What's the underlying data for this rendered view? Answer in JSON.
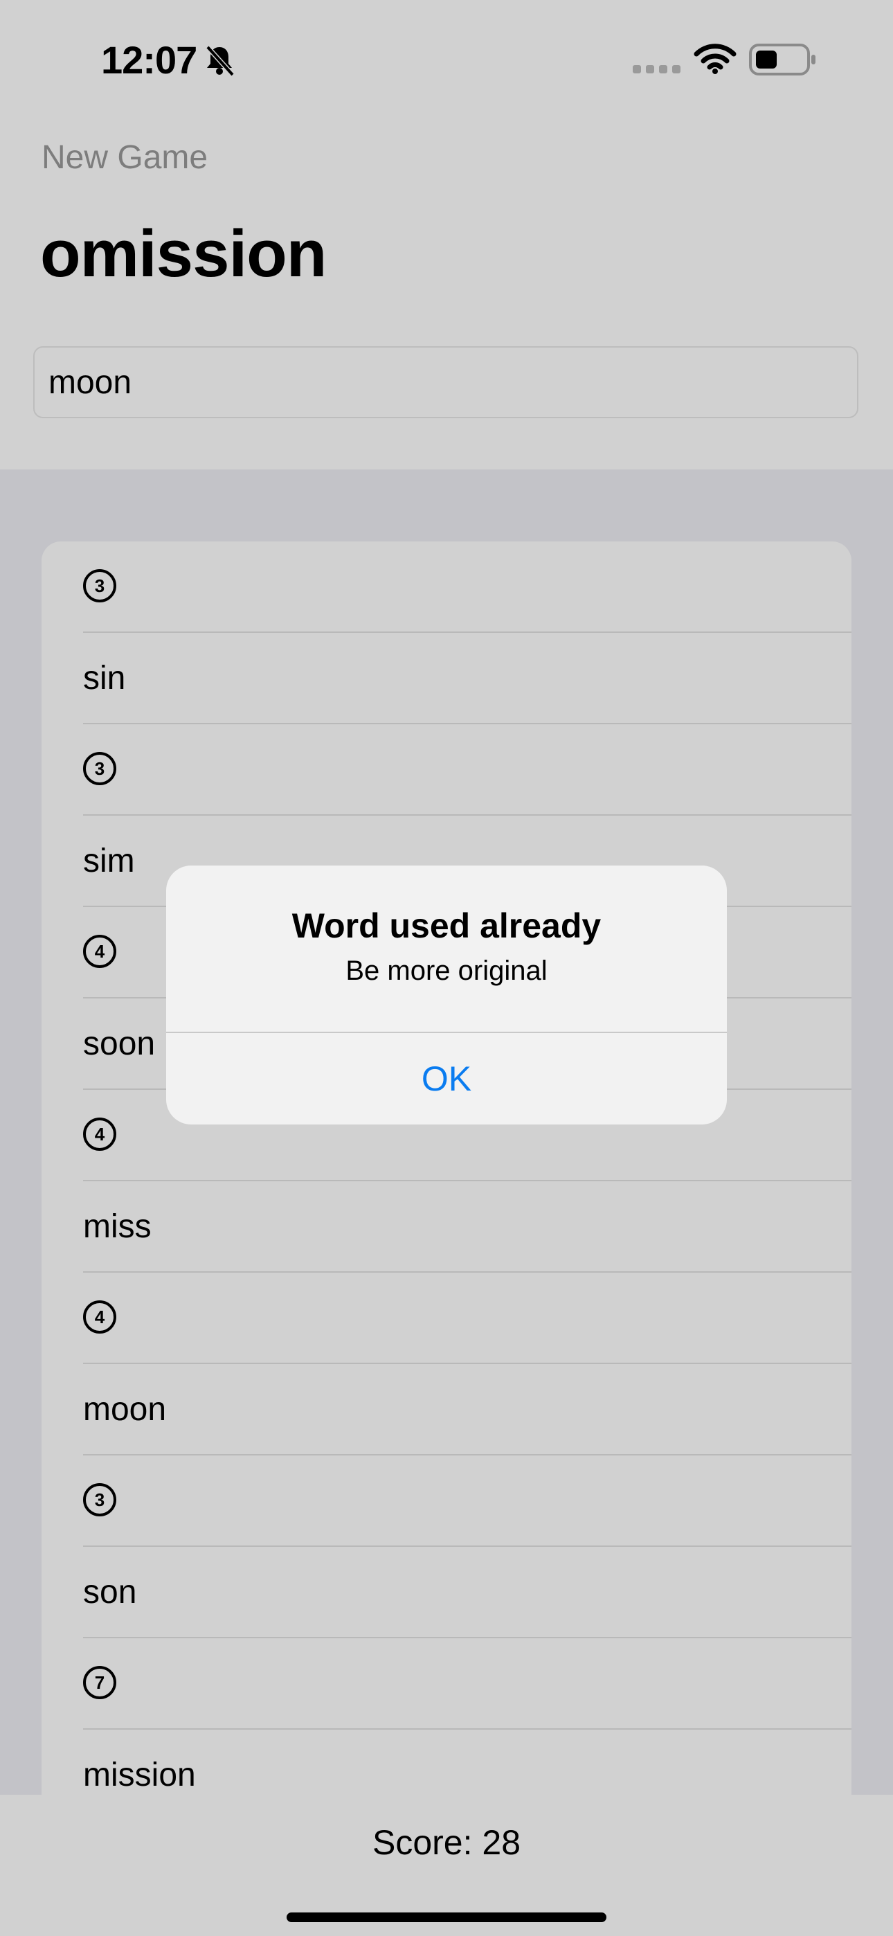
{
  "status_bar": {
    "time": "12:07"
  },
  "nav": {
    "new_game": "New Game",
    "title": "omission"
  },
  "input": {
    "value": "moon"
  },
  "words": [
    {
      "word": "sin",
      "score": "3"
    },
    {
      "word": "sim",
      "score": "3"
    },
    {
      "word": "soon",
      "score": "4"
    },
    {
      "word": "miss",
      "score": "4"
    },
    {
      "word": "moon",
      "score": "4"
    },
    {
      "word": "son",
      "score": "3"
    },
    {
      "word": "mission",
      "score": "7"
    }
  ],
  "footer": {
    "score_text": "Score: 28"
  },
  "alert": {
    "title": "Word used already",
    "message": "Be more original",
    "ok_label": "OK"
  },
  "colors": {
    "accent": "#0A7CF0",
    "backdrop": "#C3C3C8",
    "surface": "#D1D1D1"
  },
  "icons": [
    "bell-slash-icon",
    "signal-icon",
    "wifi-icon",
    "battery-icon"
  ]
}
